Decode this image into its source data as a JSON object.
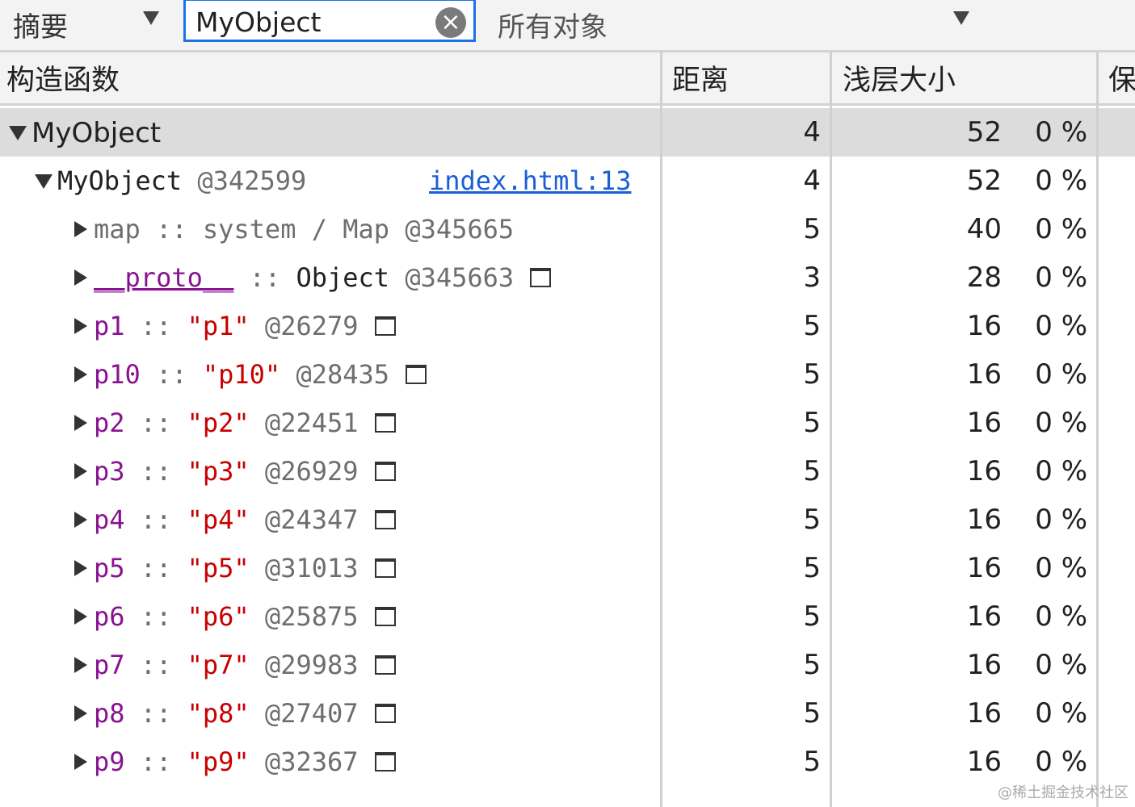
{
  "toolbar": {
    "view": "摘要",
    "filter_value": "MyObject",
    "scope": "所有对象"
  },
  "columns": {
    "constructor": "构造函数",
    "distance": "距离",
    "shallow_size": "浅层大小",
    "retained": "保"
  },
  "group": {
    "name": "MyObject",
    "distance": "4",
    "shallow": "52",
    "shallow_pct": "0 %"
  },
  "instance": {
    "name": "MyObject",
    "id": "@342599",
    "link": "index.html:13",
    "distance": "4",
    "shallow": "52",
    "shallow_pct": "0 %"
  },
  "map_row": {
    "prop": "map",
    "sep": "::",
    "type": "system / Map",
    "id": "@345665",
    "distance": "5",
    "shallow": "40",
    "shallow_pct": "0 %"
  },
  "proto_row": {
    "prop": "__proto__",
    "sep": "::",
    "type": "Object",
    "id": "@345663",
    "distance": "3",
    "shallow": "28",
    "shallow_pct": "0 %"
  },
  "props": [
    {
      "prop": "p1",
      "sep": "::",
      "value": "\"p1\"",
      "id": "@26279",
      "distance": "5",
      "shallow": "16",
      "pct": "0 %"
    },
    {
      "prop": "p10",
      "sep": "::",
      "value": "\"p10\"",
      "id": "@28435",
      "distance": "5",
      "shallow": "16",
      "pct": "0 %"
    },
    {
      "prop": "p2",
      "sep": "::",
      "value": "\"p2\"",
      "id": "@22451",
      "distance": "5",
      "shallow": "16",
      "pct": "0 %"
    },
    {
      "prop": "p3",
      "sep": "::",
      "value": "\"p3\"",
      "id": "@26929",
      "distance": "5",
      "shallow": "16",
      "pct": "0 %"
    },
    {
      "prop": "p4",
      "sep": "::",
      "value": "\"p4\"",
      "id": "@24347",
      "distance": "5",
      "shallow": "16",
      "pct": "0 %"
    },
    {
      "prop": "p5",
      "sep": "::",
      "value": "\"p5\"",
      "id": "@31013",
      "distance": "5",
      "shallow": "16",
      "pct": "0 %"
    },
    {
      "prop": "p6",
      "sep": "::",
      "value": "\"p6\"",
      "id": "@25875",
      "distance": "5",
      "shallow": "16",
      "pct": "0 %"
    },
    {
      "prop": "p7",
      "sep": "::",
      "value": "\"p7\"",
      "id": "@29983",
      "distance": "5",
      "shallow": "16",
      "pct": "0 %"
    },
    {
      "prop": "p8",
      "sep": "::",
      "value": "\"p8\"",
      "id": "@27407",
      "distance": "5",
      "shallow": "16",
      "pct": "0 %"
    },
    {
      "prop": "p9",
      "sep": "::",
      "value": "\"p9\"",
      "id": "@32367",
      "distance": "5",
      "shallow": "16",
      "pct": "0 %"
    }
  ],
  "watermark": "@稀土掘金技术社区"
}
